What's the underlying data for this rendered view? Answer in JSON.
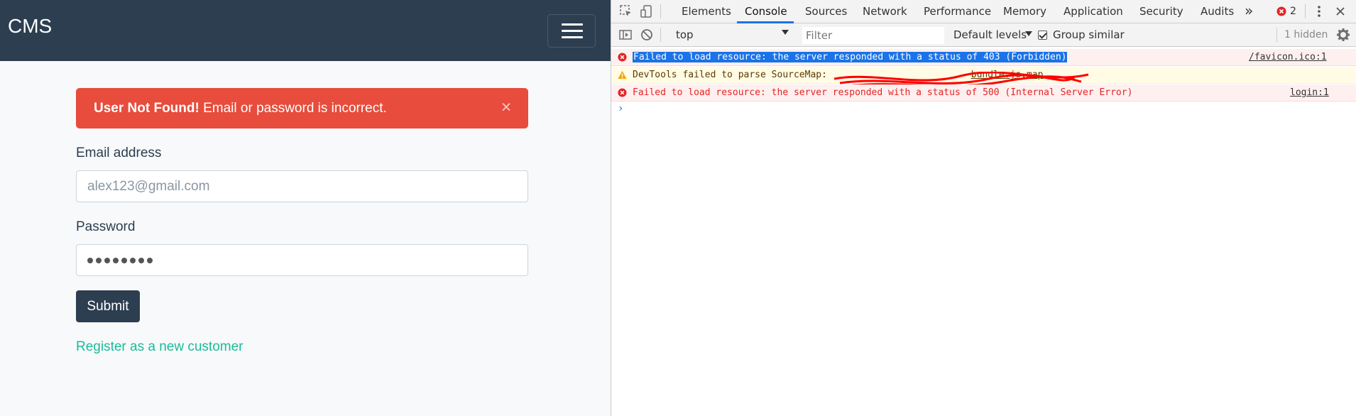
{
  "app": {
    "brand": "CMS",
    "alert": {
      "title": "User Not Found!",
      "message": " Email or password is incorrect.",
      "close": "×"
    },
    "email": {
      "label": "Email address",
      "value": "alex123@gmail.com"
    },
    "password": {
      "label": "Password",
      "masked_length": 8
    },
    "submit_label": "Submit",
    "register_link": "Register as a new customer"
  },
  "devtools": {
    "tabs": [
      {
        "label": "Elements"
      },
      {
        "label": "Console",
        "active": true
      },
      {
        "label": "Sources"
      },
      {
        "label": "Network"
      },
      {
        "label": "Performance"
      },
      {
        "label": "Memory"
      },
      {
        "label": "Application"
      },
      {
        "label": "Security"
      },
      {
        "label": "Audits"
      }
    ],
    "more_tabs": "»",
    "error_count": "2",
    "context": "top",
    "filter_placeholder": "Filter",
    "levels": "Default levels",
    "group_similar": "Group similar",
    "hidden": "1 hidden",
    "messages": [
      {
        "level": "error",
        "text": "Failed to load resource: the server responded with a status of 403 (Forbidden)",
        "source": "/favicon.ico:1"
      },
      {
        "level": "warning",
        "prefix": "DevTools failed to parse SourceMap: ",
        "url_visible": "bundle.js.map"
      },
      {
        "level": "error",
        "text": "Failed to load resource: the server responded with a status of 500 (Internal Server Error)",
        "source": "login:1"
      }
    ],
    "prompt": "›"
  },
  "colors": {
    "navbar": "#2c3e50",
    "alert": "#e74c3c",
    "link": "#18bc9c",
    "error_text": "#e32424",
    "selection": "#1a73e8"
  }
}
